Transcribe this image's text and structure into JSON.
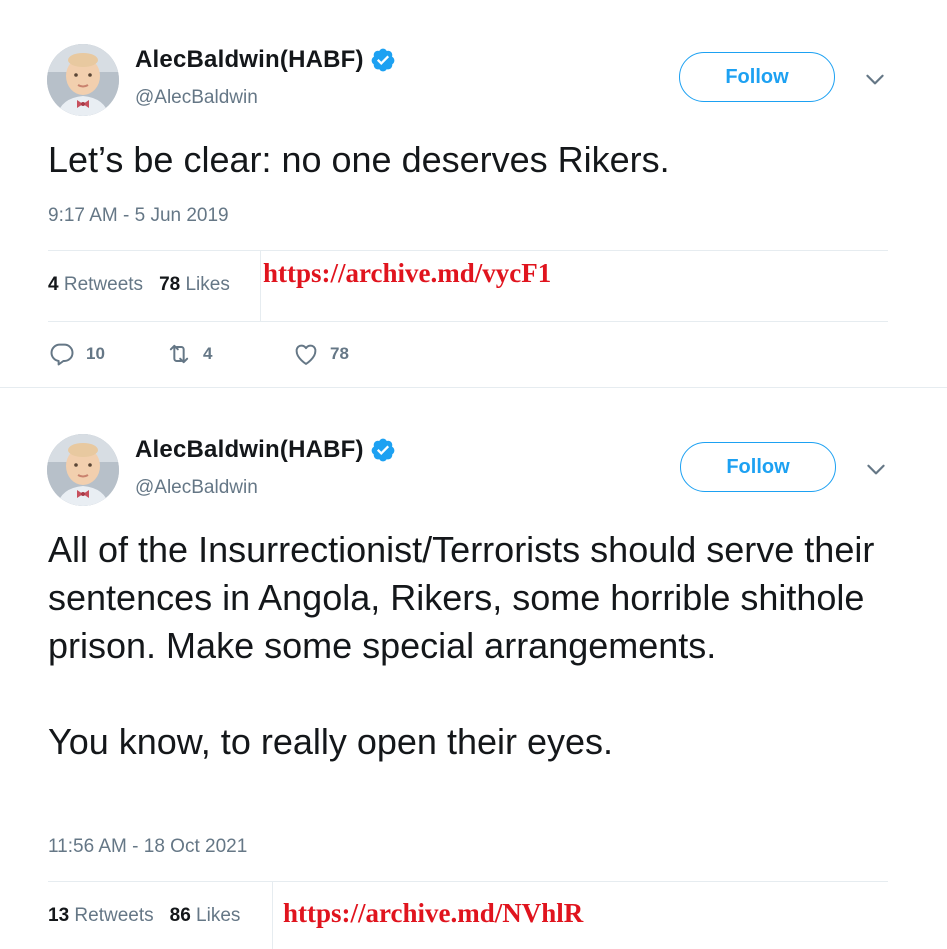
{
  "tweets": [
    {
      "display_name": "AlecBaldwin(HABF)",
      "handle": "@AlecBaldwin",
      "follow_label": "Follow",
      "text": "Let’s be clear: no one deserves Rikers.",
      "timestamp": "9:17 AM - 5 Jun 2019",
      "retweets_count": "4",
      "retweets_label": "Retweets",
      "likes_count": "78",
      "likes_label": "Likes",
      "archive_link": "https://archive.md/vycF1",
      "actions": {
        "replies": "10",
        "retweets": "4",
        "likes": "78"
      }
    },
    {
      "display_name": "AlecBaldwin(HABF)",
      "handle": "@AlecBaldwin",
      "follow_label": "Follow",
      "text": "All of the Insurrectionist/Terrorists should serve their sentences in Angola, Rikers, some horrible shithole prison. Make some special arrangements.\n\nYou know, to really open their eyes.",
      "timestamp": "11:56 AM - 18 Oct 2021",
      "retweets_count": "13",
      "retweets_label": "Retweets",
      "likes_count": "86",
      "likes_label": "Likes",
      "archive_link": "https://archive.md/NVhlR"
    }
  ],
  "colors": {
    "accent": "#1da1f2",
    "secondary_text": "#657786",
    "archive_link": "#e0141e",
    "divider": "#e6ecf0"
  },
  "icons": [
    "verified-badge-icon",
    "chevron-down-icon",
    "reply-icon",
    "retweet-icon",
    "like-heart-icon"
  ]
}
